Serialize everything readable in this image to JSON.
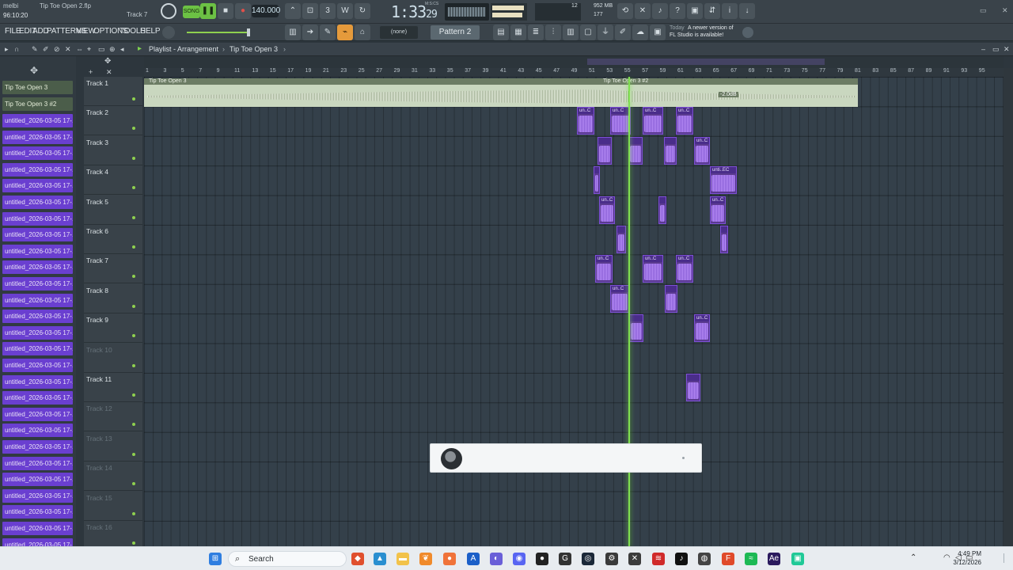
{
  "window": {
    "user": "melbi",
    "file_title": "Tip Toe Open 2.flp",
    "hint_time": "96:10:20",
    "focused_track": "Track 7"
  },
  "transport": {
    "mode": "SONG",
    "bpm": "140.000",
    "time_main": "1:33",
    "time_ticks": "29",
    "time_label": "M:S:CS",
    "memory_top": "12",
    "memory_mb": "952 MB",
    "memory_bottom": "177"
  },
  "menu": [
    "FILE",
    "EDIT",
    "ADD",
    "PATTERNS",
    "VIEW",
    "OPTIONS",
    "TOOLS",
    "HELP"
  ],
  "toolbar": {
    "none_label": "(none)",
    "pattern_label": "Pattern 2",
    "news_today": "Today",
    "news_text_1": "A newer version of",
    "news_text_2": "FL Studio is available!"
  },
  "playlist": {
    "breadcrumb_1": "Playlist - Arrangement",
    "breadcrumb_2": "Tip Toe Open 3"
  },
  "ruler_ticks": [
    "1",
    "3",
    "5",
    "7",
    "9",
    "11",
    "13",
    "15",
    "17",
    "19",
    "21",
    "23",
    "25",
    "27",
    "29",
    "31",
    "33",
    "35",
    "37",
    "39",
    "41",
    "43",
    "45",
    "47",
    "49",
    "51",
    "53",
    "55",
    "57",
    "59",
    "61",
    "63",
    "65",
    "67",
    "69",
    "71",
    "73",
    "75",
    "77",
    "79",
    "81",
    "83",
    "85",
    "87",
    "89",
    "91",
    "93",
    "95"
  ],
  "picker": {
    "audio_items": [
      "Tip Toe Open 3",
      "Tip Toe Open 3 #2"
    ],
    "clip_items": [
      "untitled_2026-03-05 17-...",
      "untitled_2026-03-05 17-...",
      "untitled_2026-03-05 17-...",
      "untitled_2026-03-05 17-...",
      "untitled_2026-03-05 17-...",
      "untitled_2026-03-05 17-...",
      "untitled_2026-03-05 17-...",
      "untitled_2026-03-05 17-...",
      "untitled_2026-03-05 17-...",
      "untitled_2026-03-05 17-...",
      "untitled_2026-03-05 17-...",
      "untitled_2026-03-05 17-...",
      "untitled_2026-03-05 17-...",
      "untitled_2026-03-05 17-...",
      "untitled_2026-03-05 17-...",
      "untitled_2026-03-05 17-...",
      "untitled_2026-03-05 17-...",
      "untitled_2026-03-05 17-...",
      "untitled_2026-03-05 17-...",
      "untitled_2026-03-05 17-...",
      "untitled_2026-03-05 17-...",
      "untitled_2026-03-05 17-...",
      "untitled_2026-03-05 17-...",
      "untitled_2026-03-05 17-...",
      "untitled_2026-03-05 17-...",
      "untitled_2026-03-05 17-...",
      "untitled_2026-03-05 17-..."
    ]
  },
  "tracks": [
    {
      "name": "Track 1",
      "dim": false
    },
    {
      "name": "Track 2",
      "dim": false
    },
    {
      "name": "Track 3",
      "dim": false
    },
    {
      "name": "Track 4",
      "dim": false
    },
    {
      "name": "Track 5",
      "dim": false
    },
    {
      "name": "Track 6",
      "dim": false
    },
    {
      "name": "Track 7",
      "dim": false
    },
    {
      "name": "Track 8",
      "dim": false
    },
    {
      "name": "Track 9",
      "dim": false
    },
    {
      "name": "Track 10",
      "dim": true
    },
    {
      "name": "Track 11",
      "dim": false
    },
    {
      "name": "Track 12",
      "dim": true
    },
    {
      "name": "Track 13",
      "dim": true
    },
    {
      "name": "Track 14",
      "dim": true
    },
    {
      "name": "Track 15",
      "dim": true
    },
    {
      "name": "Track 16",
      "dim": true
    }
  ],
  "arrangement": {
    "main_clip_1": "Tip Toe Open 3",
    "main_clip_2": "Tip Toe Open 3 #2",
    "main_gain": "-2.0dB",
    "clip_label_short": "un..C",
    "clip_label_long": "unti..EC"
  },
  "taskbar": {
    "search_label": "Search",
    "time": "4:49 PM",
    "date": "3/12/2026"
  }
}
